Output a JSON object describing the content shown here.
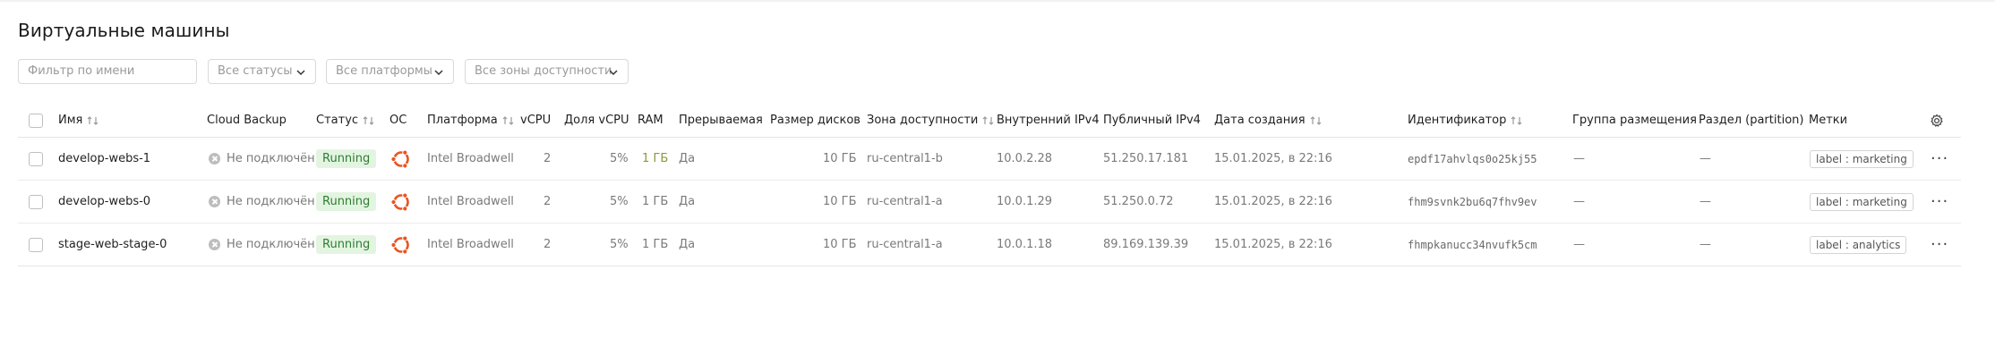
{
  "page": {
    "title": "Виртуальные машины"
  },
  "filters": {
    "name_placeholder": "Фильтр по имени",
    "status": "Все статусы",
    "platform": "Все платформы",
    "zone": "Все зоны доступности"
  },
  "table": {
    "columns": {
      "name": "Имя",
      "backup": "Cloud Backup",
      "status": "Статус",
      "os": "ОС",
      "platform": "Платформа",
      "vcpu": "vCPU",
      "vcpu_share": "Доля vCPU",
      "ram": "RAM",
      "preemptible": "Прерываемая",
      "disk_size": "Размер дисков",
      "zone": "Зона доступности",
      "internal_ip": "Внутренний IPv4",
      "public_ip": "Публичный IPv4",
      "created": "Дата создания",
      "id": "Идентификатор",
      "placement_group": "Группа размещения",
      "partition": "Раздел (partition)",
      "labels": "Метки"
    },
    "rows": [
      {
        "name": "develop-webs-1",
        "backup": "Не подключён",
        "status": "Running",
        "os_icon": "ubuntu-icon",
        "platform": "Intel Broadwell",
        "vcpu": "2",
        "vcpu_share": "5%",
        "ram": "1 ГБ",
        "preemptible": "Да",
        "disk_size": "10 ГБ",
        "zone": "ru-central1-b",
        "internal_ip": "10.0.2.28",
        "public_ip": "51.250.17.181",
        "created": "15.01.2025, в 22:16",
        "id": "epdf17ahvlqs0o25kj55",
        "placement_group": "—",
        "partition": "—",
        "label": "label : marketing"
      },
      {
        "name": "develop-webs-0",
        "backup": "Не подключён",
        "status": "Running",
        "os_icon": "ubuntu-icon",
        "platform": "Intel Broadwell",
        "vcpu": "2",
        "vcpu_share": "5%",
        "ram": "1 ГБ",
        "preemptible": "Да",
        "disk_size": "10 ГБ",
        "zone": "ru-central1-a",
        "internal_ip": "10.0.1.29",
        "public_ip": "51.250.0.72",
        "created": "15.01.2025, в 22:16",
        "id": "fhm9svnk2bu6q7fhv9ev",
        "placement_group": "—",
        "partition": "—",
        "label": "label : marketing"
      },
      {
        "name": "stage-web-stage-0",
        "backup": "Не подключён",
        "status": "Running",
        "os_icon": "ubuntu-icon",
        "platform": "Intel Broadwell",
        "vcpu": "2",
        "vcpu_share": "5%",
        "ram": "1 ГБ",
        "preemptible": "Да",
        "disk_size": "10 ГБ",
        "zone": "ru-central1-a",
        "internal_ip": "10.0.1.18",
        "public_ip": "89.169.139.39",
        "created": "15.01.2025, в 22:16",
        "id": "fhmpkanucc34nvufk5cm",
        "placement_group": "—",
        "partition": "—",
        "label": "label : analytics"
      }
    ]
  },
  "colors": {
    "running_bg": "#e3f5e1",
    "running_text": "#2e7d32",
    "ubuntu": "#e95420"
  }
}
